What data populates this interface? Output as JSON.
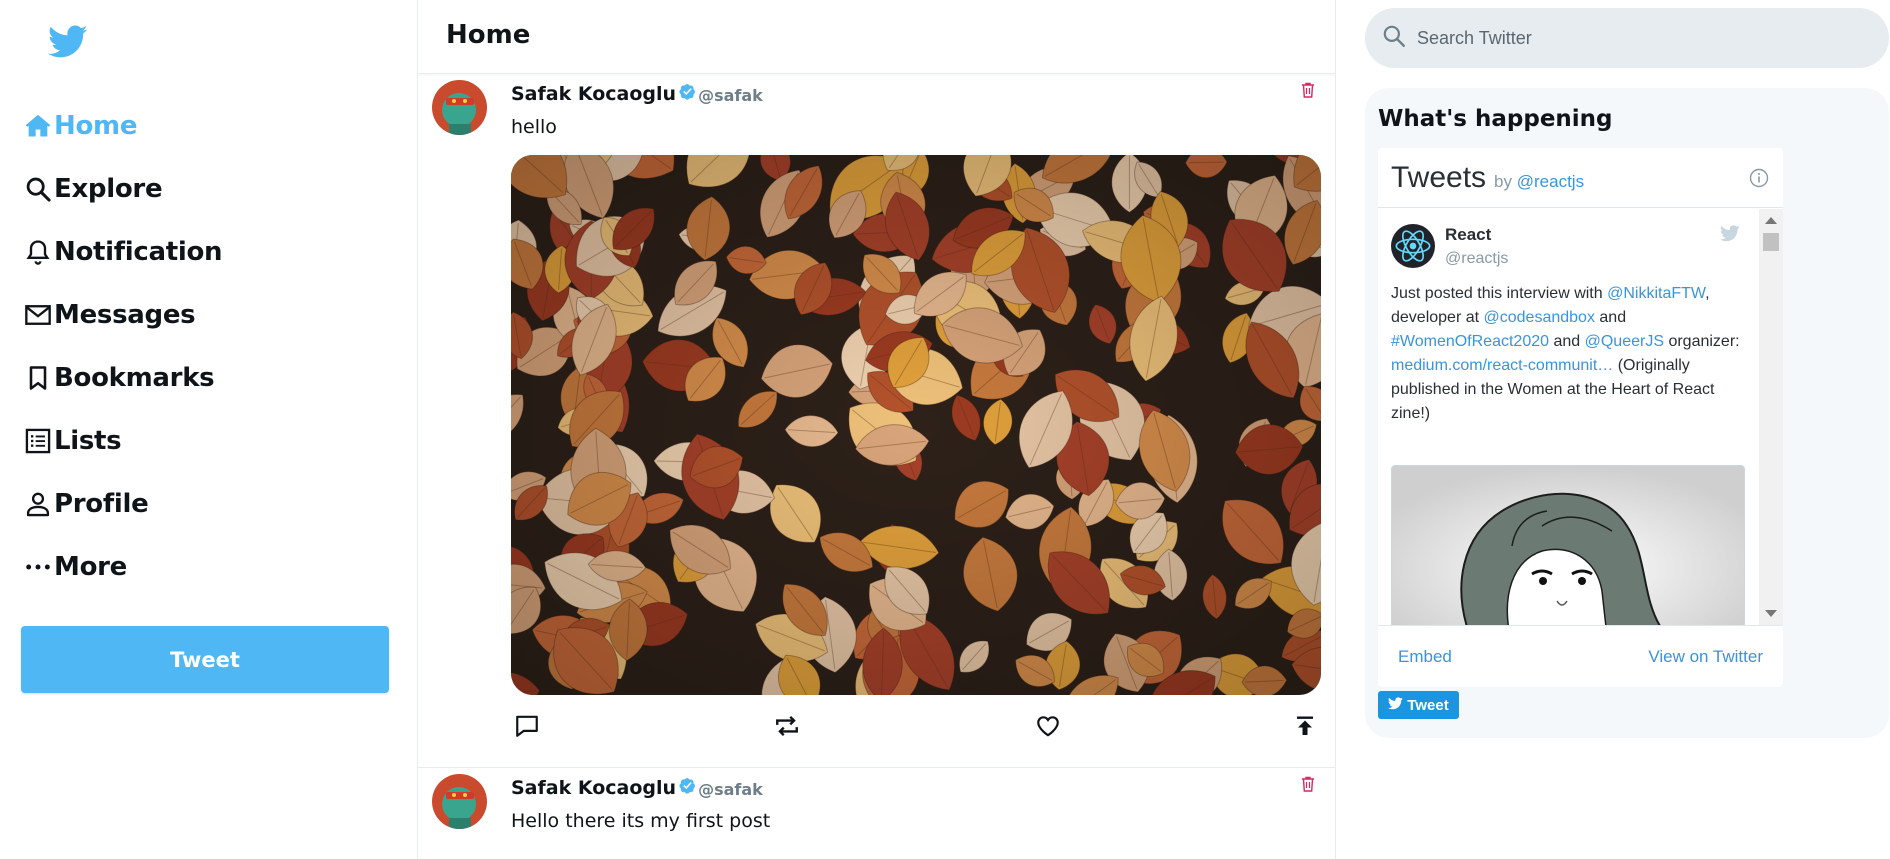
{
  "colors": {
    "accent": "#50b7f5",
    "text": "#0f1419",
    "muted": "#6e7f8a",
    "delete": "#e0245e",
    "link": "#3b94d9"
  },
  "sidebar": {
    "logo_icon": "twitter-bird-icon",
    "items": [
      {
        "label": "Home",
        "icon": "home-icon",
        "active": true
      },
      {
        "label": "Explore",
        "icon": "search-icon"
      },
      {
        "label": "Notification",
        "icon": "bell-icon"
      },
      {
        "label": "Messages",
        "icon": "mail-icon"
      },
      {
        "label": "Bookmarks",
        "icon": "bookmark-icon"
      },
      {
        "label": "Lists",
        "icon": "list-icon"
      },
      {
        "label": "Profile",
        "icon": "person-icon"
      },
      {
        "label": "More",
        "icon": "more-icon"
      }
    ],
    "tweet_button": "Tweet"
  },
  "feed": {
    "title": "Home",
    "posts": [
      {
        "name": "Safak Kocaoglu",
        "handle": "@safak",
        "text": "hello",
        "has_image": true
      },
      {
        "name": "Safak Kocaoglu",
        "handle": "@safak",
        "text": "Hello there its my first post",
        "has_image": false
      }
    ]
  },
  "right": {
    "search": {
      "placeholder": "Search Twitter"
    },
    "widget_title": "What's happening",
    "embed": {
      "title": "Tweets",
      "by": "by",
      "by_handle": "@reactjs",
      "tweet": {
        "name": "React",
        "handle": "@reactjs",
        "text_parts": [
          {
            "t": "Just posted this interview with "
          },
          {
            "t": "@NikkitaFTW",
            "link": true
          },
          {
            "t": ", developer at "
          },
          {
            "t": "@codesandbox",
            "link": true
          },
          {
            "t": " and "
          },
          {
            "t": "#WomenOfReact2020",
            "link": true
          },
          {
            "t": " and "
          },
          {
            "t": "@QueerJS",
            "link": true
          },
          {
            "t": " organizer: "
          },
          {
            "t": "medium.com/react-communit…",
            "link": true
          },
          {
            "t": " (Originally published in the Women at the Heart of React zine!)"
          }
        ]
      },
      "footer": {
        "embed": "Embed",
        "view": "View on Twitter"
      }
    },
    "share_button": "Tweet"
  }
}
